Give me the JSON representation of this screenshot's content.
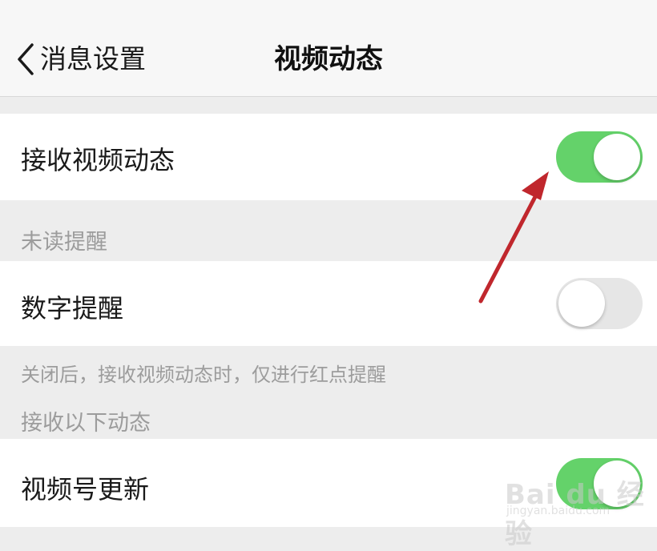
{
  "nav": {
    "back_label": "消息设置",
    "title": "视频动态"
  },
  "settings": {
    "receive": {
      "label": "接收视频动态",
      "enabled": true
    },
    "unread_section": "未读提醒",
    "number_reminder": {
      "label": "数字提醒",
      "enabled": false
    },
    "note": "关闭后，接收视频动态时，仅进行红点提醒",
    "receive_section": "接收以下动态",
    "channel_update": {
      "label": "视频号更新",
      "enabled": true
    }
  },
  "watermark": {
    "brand": "Bai du 经验",
    "sub": "jingyan.baidu.com"
  },
  "colors": {
    "toggle_on": "#64d26a",
    "toggle_off": "#e6e6e6",
    "annotation_arrow": "#c0272d"
  },
  "icons": {
    "back": "chevron-left-icon"
  }
}
